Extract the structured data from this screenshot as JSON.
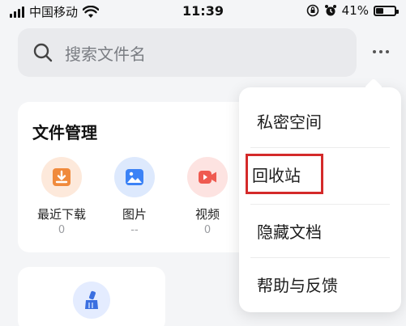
{
  "status_bar": {
    "carrier": "中国移动",
    "time": "11:39",
    "battery_percent": "41%",
    "battery_level": 0.41
  },
  "search": {
    "placeholder": "搜索文件名"
  },
  "file_management": {
    "title": "文件管理",
    "shortcuts": [
      {
        "label": "最近下载",
        "count": "0",
        "icon": "download-icon",
        "color": "#f08a3c",
        "bg": "#fde9db"
      },
      {
        "label": "图片",
        "count": "--",
        "icon": "image-icon",
        "color": "#3b82f6",
        "bg": "#dde9fd"
      },
      {
        "label": "视频",
        "count": "0",
        "icon": "video-icon",
        "color": "#ef5a50",
        "bg": "#fde3e1"
      }
    ]
  },
  "menu": {
    "items": [
      {
        "label": "私密空间"
      },
      {
        "label": "回收站",
        "highlighted": true
      },
      {
        "label": "隐藏文档"
      },
      {
        "label": "帮助与反馈"
      }
    ],
    "highlight_color": "#d42a2a"
  }
}
